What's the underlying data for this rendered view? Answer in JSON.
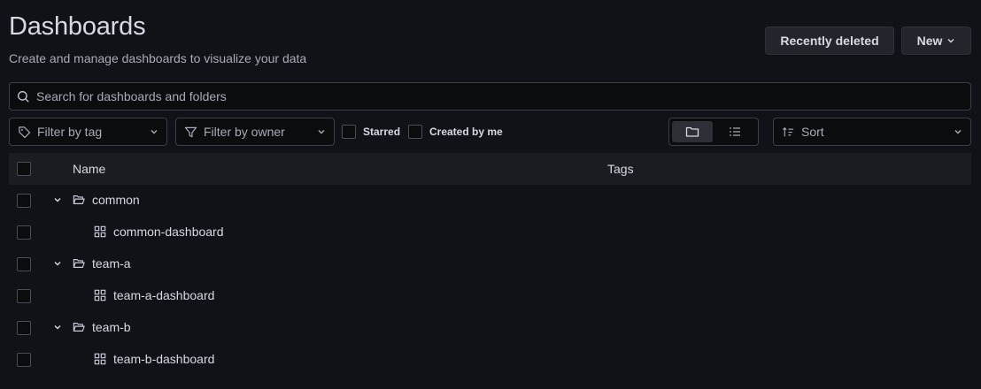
{
  "header": {
    "title": "Dashboards",
    "subtitle": "Create and manage dashboards to visualize your data",
    "recently_deleted_label": "Recently deleted",
    "new_label": "New"
  },
  "search": {
    "placeholder": "Search for dashboards and folders",
    "value": ""
  },
  "filters": {
    "tag_placeholder": "Filter by tag",
    "owner_placeholder": "Filter by owner",
    "starred_label": "Starred",
    "created_by_me_label": "Created by me",
    "sort_label": "Sort",
    "view_mode": "folders"
  },
  "table": {
    "columns": [
      "Name",
      "Tags"
    ],
    "rows": [
      {
        "type": "folder",
        "name": "common",
        "expanded": true,
        "icon": "folder-open-icon"
      },
      {
        "type": "dashboard",
        "name": "common-dashboard",
        "icon": "apps-icon"
      },
      {
        "type": "folder",
        "name": "team-a",
        "expanded": true,
        "icon": "folder-open-icon"
      },
      {
        "type": "dashboard",
        "name": "team-a-dashboard",
        "icon": "apps-icon"
      },
      {
        "type": "folder",
        "name": "team-b",
        "expanded": true,
        "icon": "folder-open-icon"
      },
      {
        "type": "dashboard",
        "name": "team-b-dashboard",
        "icon": "apps-icon"
      }
    ]
  },
  "colors": {
    "background": "#111217",
    "header_row": "#1b1c21",
    "text": "#d8d9e3",
    "muted": "#a8abb8"
  }
}
